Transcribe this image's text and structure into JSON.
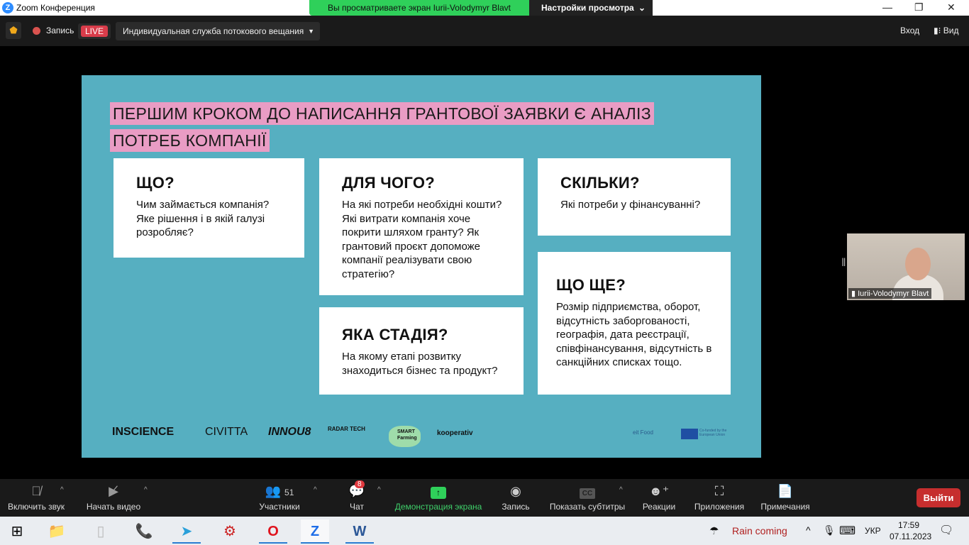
{
  "window": {
    "title": "Zoom Конференция",
    "share_banner": "Вы просматриваете экран Iurii-Volodymyr Blavt",
    "view_options": "Настройки просмотра"
  },
  "topbar": {
    "record_label": "Запись",
    "live_badge": "LIVE",
    "stream_service": "Индивидуальная служба потокового вещания",
    "login": "Вход",
    "view": "Вид"
  },
  "slide": {
    "title_line1": "ПЕРШИМ КРОКОМ ДО НАПИСАННЯ ГРАНТОВОЇ ЗАЯВКИ Є АНАЛІЗ",
    "title_line2": "ПОТРЕБ КОМПАНІЇ",
    "cards": [
      {
        "heading": "ЩО?",
        "text": "Чим займається компанія? Яке рішення і в якій галузі розробляє?"
      },
      {
        "heading": "ДЛЯ ЧОГО?",
        "text": "На які потреби необхідні кошти? Які витрати компанія хоче покрити шляхом гранту? Як грантовий проєкт допоможе компанії реалізувати свою стратегію?"
      },
      {
        "heading": "СКІЛЬКИ?",
        "text": "Які потреби у фінансуванні?"
      },
      {
        "heading": "ЯКА СТАДІЯ?",
        "text": "На якому етапі розвитку знаходиться бізнес та продукт?"
      },
      {
        "heading": "ЩО ЩЕ?",
        "text": "Розмір підприємства, оборот, відсутність заборгованості, географія, дата реєстрації, співфінансування, відсутність в санкційних списках тощо."
      }
    ],
    "logos": [
      "INSCIENCE",
      "CIVITTA",
      "INNOU8",
      "RADAR TECH",
      "SMART Farming",
      "kooperativ",
      "eit Food",
      "Co-funded by the European Union"
    ]
  },
  "participant": {
    "name": "Iurii-Volodymyr Blavt"
  },
  "toolbar": {
    "unmute": "Включить звук",
    "start_video": "Начать видео",
    "participants": "Участники",
    "participants_count": "51",
    "chat": "Чат",
    "chat_badge": "8",
    "share": "Демонстрация экрана",
    "record": "Запись",
    "cc_icon": "CC",
    "captions": "Показать субтитры",
    "reactions": "Реакции",
    "apps": "Приложения",
    "notes": "Примечания",
    "leave": "Выйти"
  },
  "taskbar": {
    "weather": "Rain coming",
    "lang": "УКР",
    "time": "17:59",
    "date": "07.11.2023"
  },
  "colors": {
    "slide_bg": "#56afc1",
    "highlight": "#e99cc4",
    "share_green": "#2fd05a",
    "leave_red": "#c62e2e"
  }
}
